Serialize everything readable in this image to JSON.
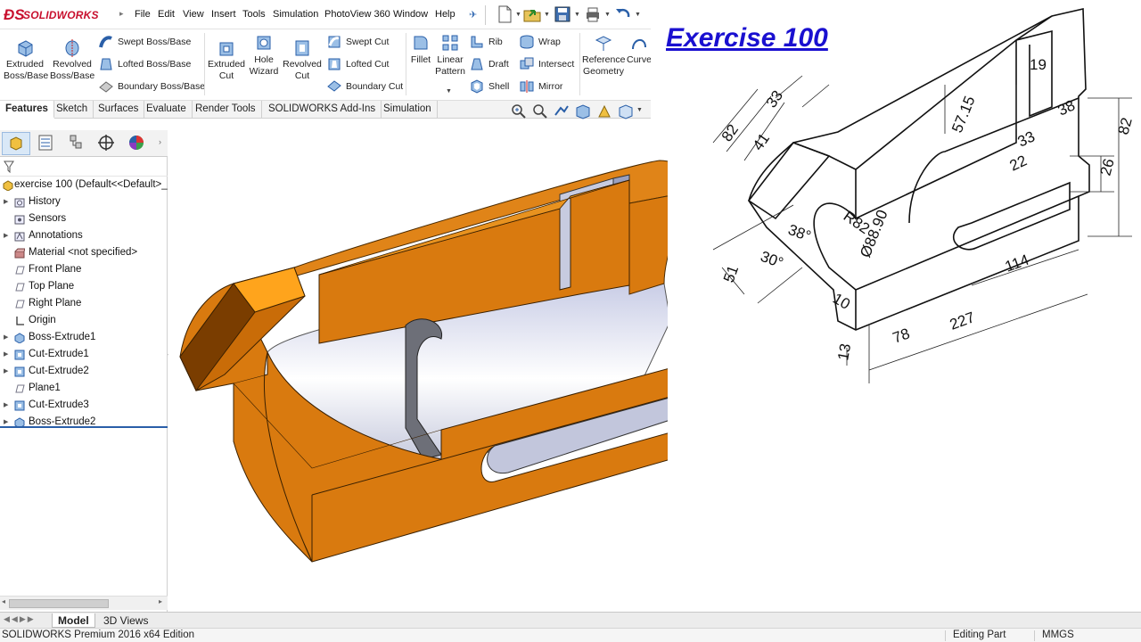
{
  "app": {
    "brand": "SOLIDWORKS",
    "menu": [
      "File",
      "Edit",
      "View",
      "Insert",
      "Tools",
      "Simulation",
      "PhotoView 360",
      "Window",
      "Help"
    ]
  },
  "ribbon": {
    "extruded_boss": "Extruded\nBoss/Base",
    "revolved_boss": "Revolved\nBoss/Base",
    "swept_boss": "Swept Boss/Base",
    "lofted_boss": "Lofted Boss/Base",
    "boundary_boss": "Boundary Boss/Base",
    "extruded_cut": "Extruded\nCut",
    "hole_wizard": "Hole\nWizard",
    "revolved_cut": "Revolved\nCut",
    "swept_cut": "Swept Cut",
    "lofted_cut": "Lofted Cut",
    "boundary_cut": "Boundary Cut",
    "fillet": "Fillet",
    "linear_pattern": "Linear\nPattern",
    "rib": "Rib",
    "draft": "Draft",
    "shell": "Shell",
    "wrap": "Wrap",
    "intersect": "Intersect",
    "mirror": "Mirror",
    "reference_geometry": "Reference\nGeometry",
    "curves": "Curves"
  },
  "tabs": [
    "Features",
    "Sketch",
    "Surfaces",
    "Evaluate",
    "Render Tools",
    "SOLIDWORKS Add-Ins",
    "Simulation"
  ],
  "tree": {
    "root": "exercise 100  (Default<<Default>_",
    "items": [
      {
        "label": "History",
        "expandable": true
      },
      {
        "label": "Sensors",
        "expandable": false
      },
      {
        "label": "Annotations",
        "expandable": true
      },
      {
        "label": "Material <not specified>",
        "expandable": false
      },
      {
        "label": "Front Plane",
        "expandable": false
      },
      {
        "label": "Top Plane",
        "expandable": false
      },
      {
        "label": "Right Plane",
        "expandable": false
      },
      {
        "label": "Origin",
        "expandable": false
      },
      {
        "label": "Boss-Extrude1",
        "expandable": true
      },
      {
        "label": "Cut-Extrude1",
        "expandable": true
      },
      {
        "label": "Cut-Extrude2",
        "expandable": true
      },
      {
        "label": "Plane1",
        "expandable": false
      },
      {
        "label": "Cut-Extrude3",
        "expandable": true
      },
      {
        "label": "Boss-Extrude2",
        "expandable": true
      }
    ]
  },
  "exercise": {
    "title": "Exercise 100",
    "dims": [
      "82",
      "33",
      "41",
      "19",
      "57.15",
      "38",
      "33",
      "22",
      "82",
      "26",
      "R82",
      "38°",
      "30°",
      "51",
      "Ø88.90",
      "10",
      "13",
      "78",
      "227",
      "114"
    ]
  },
  "bottom_tabs": [
    "Model",
    "3D Views"
  ],
  "status": {
    "edition": "SOLIDWORKS Premium 2016 x64 Edition",
    "mode": "Editing Part",
    "units": "MMGS"
  },
  "colors": {
    "part_orange": "#d97a0f",
    "exercise_blue": "#1a10d0",
    "logo_red": "#c8102e"
  }
}
